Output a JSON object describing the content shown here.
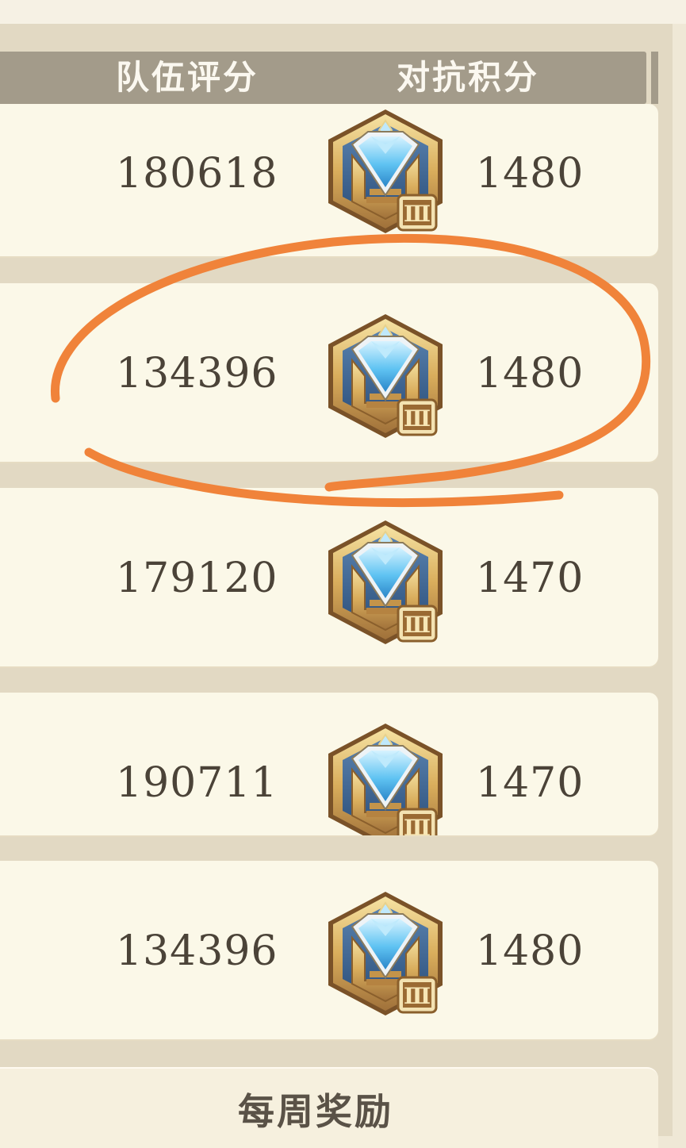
{
  "header": {
    "team_score_label": "队伍评分",
    "battle_points_label": "对抗积分"
  },
  "rows": [
    {
      "team_score": "180618",
      "battle_points": "1480",
      "rank_tier": "Ⅲ"
    },
    {
      "team_score": "134396",
      "battle_points": "1480",
      "rank_tier": "Ⅲ"
    },
    {
      "team_score": "179120",
      "battle_points": "1470",
      "rank_tier": "Ⅲ"
    },
    {
      "team_score": "190711",
      "battle_points": "1470",
      "rank_tier": "Ⅲ"
    },
    {
      "team_score": "134396",
      "battle_points": "1480",
      "rank_tier": "Ⅲ"
    }
  ],
  "footer": {
    "weekly_reward_label": "每周奖励"
  },
  "icons": {
    "rank_badge": "diamond-rank-badge-icon"
  },
  "colors": {
    "highlight_ring": "#f0833a",
    "header_bg": "#a39b8a",
    "row_bg": "#fbf8e8",
    "text": "#4b4338"
  }
}
